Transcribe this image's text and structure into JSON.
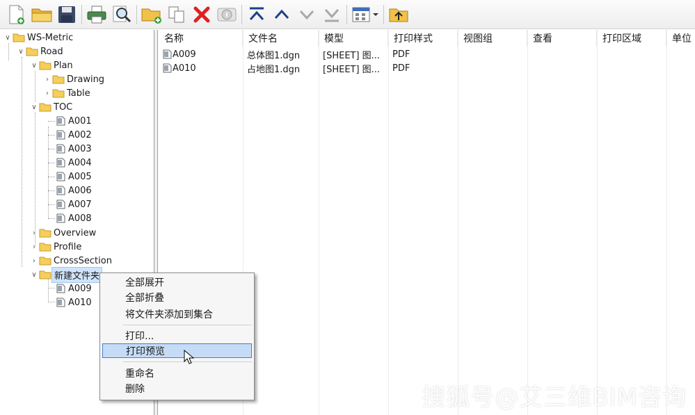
{
  "toolbar": {
    "buttons": [
      "new-file-icon",
      "open-folder-icon",
      "save-icon",
      "print-icon",
      "zoom-icon",
      "new-folder-icon",
      "copy-icon",
      "delete-icon",
      "properties-icon",
      "move-top-icon",
      "move-up-icon",
      "move-down-icon",
      "move-bottom-icon",
      "view-options-icon",
      "up-level-icon"
    ]
  },
  "tree": {
    "root": "WS-Metric",
    "road": "Road",
    "plan": "Plan",
    "drawing": "Drawing",
    "table": "Table",
    "toc": "TOC",
    "toc_items": [
      "A001",
      "A002",
      "A003",
      "A004",
      "A005",
      "A006",
      "A007",
      "A008"
    ],
    "overview": "Overview",
    "profile": "Profile",
    "crosssection": "CrossSection",
    "new_folder": "新建文件夹",
    "new_folder_items": [
      "A009",
      "A010"
    ]
  },
  "list": {
    "columns": [
      "名称",
      "文件名",
      "模型",
      "打印样式",
      "视图组",
      "查看",
      "打印区域",
      "单位"
    ],
    "rows": [
      {
        "name": "A009",
        "file": "总体图1.dgn",
        "model": "[SHEET] 图...",
        "style": "PDF"
      },
      {
        "name": "A010",
        "file": "占地图1.dgn",
        "model": "[SHEET] 图...",
        "style": "PDF"
      }
    ]
  },
  "context_menu": {
    "expand_all": "全部展开",
    "collapse_all": "全部折叠",
    "add_to_set": "将文件夹添加到集合",
    "print": "打印...",
    "print_preview": "打印预览",
    "rename": "重命名",
    "delete": "删除"
  },
  "watermark": "搜狐号@艾三维BIM咨询",
  "colors": {
    "selection": "#cfe4fb",
    "highlight": "#c6dcf6",
    "folder": "#f5cf5a",
    "delete": "#e02020"
  }
}
